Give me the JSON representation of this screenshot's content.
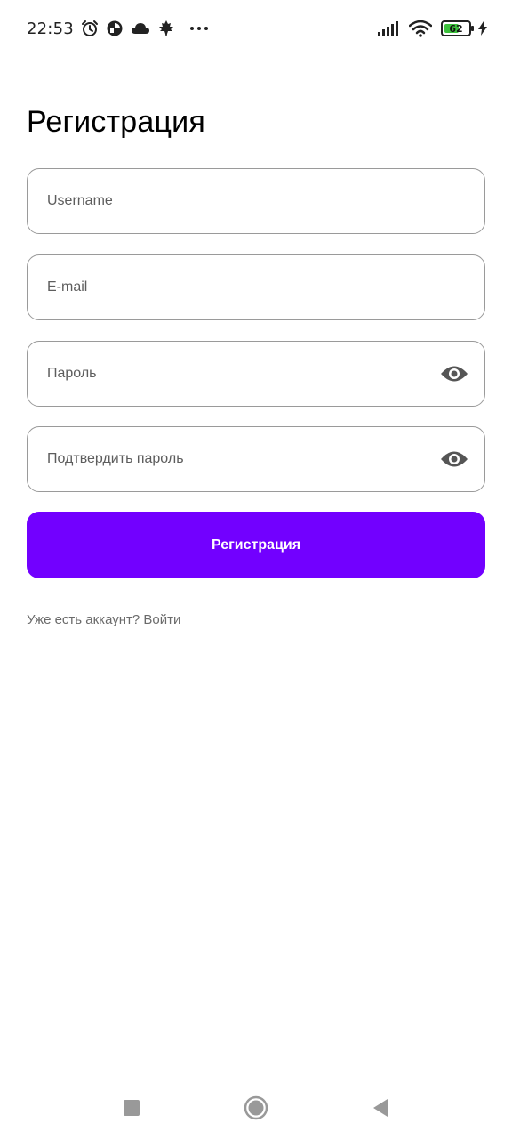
{
  "status_bar": {
    "time": "22:53",
    "battery_level": "62",
    "battery_fraction": 0.62,
    "icons": [
      "alarm-icon",
      "data-saver-icon",
      "cloud-icon",
      "maple-leaf-icon",
      "more-dots-icon",
      "signal-icon",
      "wifi-icon",
      "battery-icon",
      "charging-icon"
    ]
  },
  "page": {
    "title": "Регистрация"
  },
  "form": {
    "username_placeholder": "Username",
    "email_placeholder": "E-mail",
    "password_placeholder": "Пароль",
    "confirm_password_placeholder": "Подтвердить пароль",
    "submit_label": "Регистрация"
  },
  "footer": {
    "login_text": "Уже есть аккаунт? Войти"
  },
  "colors": {
    "accent": "#7200ff",
    "border": "#9a9a9a",
    "link": "#6b6b6b"
  },
  "nav_bar": {
    "icons": [
      "recents-square-icon",
      "home-circle-icon",
      "back-triangle-icon"
    ]
  }
}
